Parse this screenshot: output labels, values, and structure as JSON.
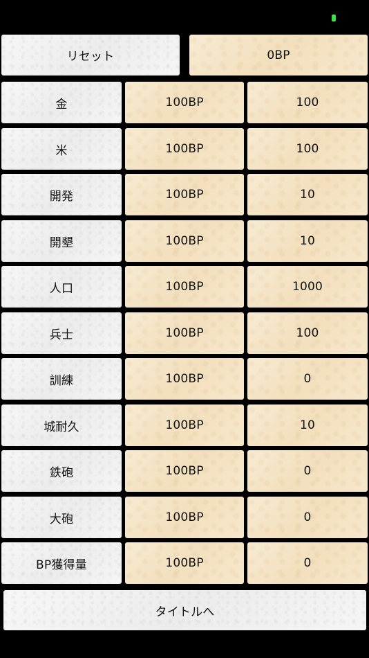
{
  "header": {
    "reset_label": "リセット",
    "bp_total": "0BP"
  },
  "rows": [
    {
      "label": "金",
      "cost": "100BP",
      "value": "100"
    },
    {
      "label": "米",
      "cost": "100BP",
      "value": "100"
    },
    {
      "label": "開発",
      "cost": "100BP",
      "value": "10"
    },
    {
      "label": "開墾",
      "cost": "100BP",
      "value": "10"
    },
    {
      "label": "人口",
      "cost": "100BP",
      "value": "1000"
    },
    {
      "label": "兵士",
      "cost": "100BP",
      "value": "100"
    },
    {
      "label": "訓練",
      "cost": "100BP",
      "value": "0"
    },
    {
      "label": "城耐久",
      "cost": "100BP",
      "value": "10"
    },
    {
      "label": "鉄砲",
      "cost": "100BP",
      "value": "0"
    },
    {
      "label": "大砲",
      "cost": "100BP",
      "value": "0"
    },
    {
      "label": "BP獲得量",
      "cost": "100BP",
      "value": "0"
    }
  ],
  "footer": {
    "title_button_label": "タイトルへ"
  },
  "colors": {
    "background": "#000000",
    "label_cell": "#f3f3f3",
    "cost_cell": "#f6e7cb",
    "status_indicator": "#3ee04a"
  }
}
